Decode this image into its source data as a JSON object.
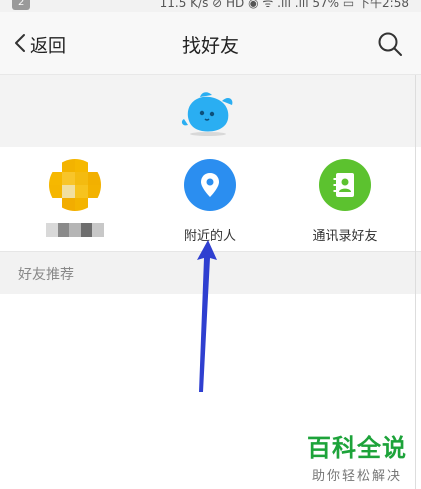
{
  "status_bar": {
    "notification_count": "2",
    "info": "11.5 K/s ⊘ HD ◉ ᯤ .ıll .ıll 57% ▭ 下午2:58"
  },
  "header": {
    "back_label": "返回",
    "title": "找好友"
  },
  "shortcuts": [
    {
      "label": "",
      "color": "#f6b800"
    },
    {
      "label": "附近的人",
      "color": "#2b8ef0"
    },
    {
      "label": "通讯录好友",
      "color": "#5cc22f"
    }
  ],
  "section": {
    "title": "好友推荐"
  },
  "watermark": {
    "title": "百科全说",
    "subtitle": "助你轻松解决"
  },
  "colors": {
    "arrow": "#2f3fd0",
    "mascot": "#2aaef2"
  }
}
